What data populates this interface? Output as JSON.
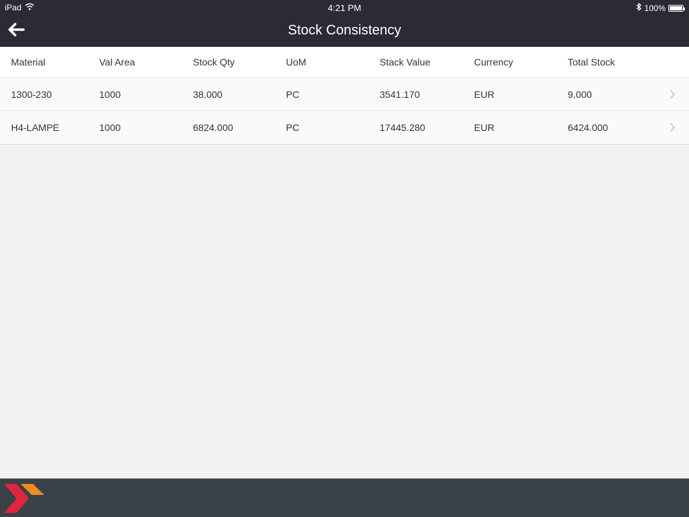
{
  "status_bar": {
    "device": "iPad",
    "time": "4:21 PM",
    "battery": "100%"
  },
  "nav": {
    "title": "Stock Consistency"
  },
  "table": {
    "columns": [
      "Material",
      "Val Area",
      "Stock Qty",
      "UoM",
      "Stack Value",
      "Currency",
      "Total Stock"
    ],
    "rows": [
      [
        "1300-230",
        "1000",
        "38.000",
        "PC",
        "3541.170",
        "EUR",
        "9.000"
      ],
      [
        "H4-LAMPE",
        "1000",
        "6824.000",
        "PC",
        "17445.280",
        "EUR",
        "6424.000"
      ]
    ]
  },
  "colors": {
    "header_bg": "#2b2b36",
    "footer_bg": "#3b4149",
    "logo_red": "#e0263c",
    "logo_orange": "#f08c1e"
  }
}
